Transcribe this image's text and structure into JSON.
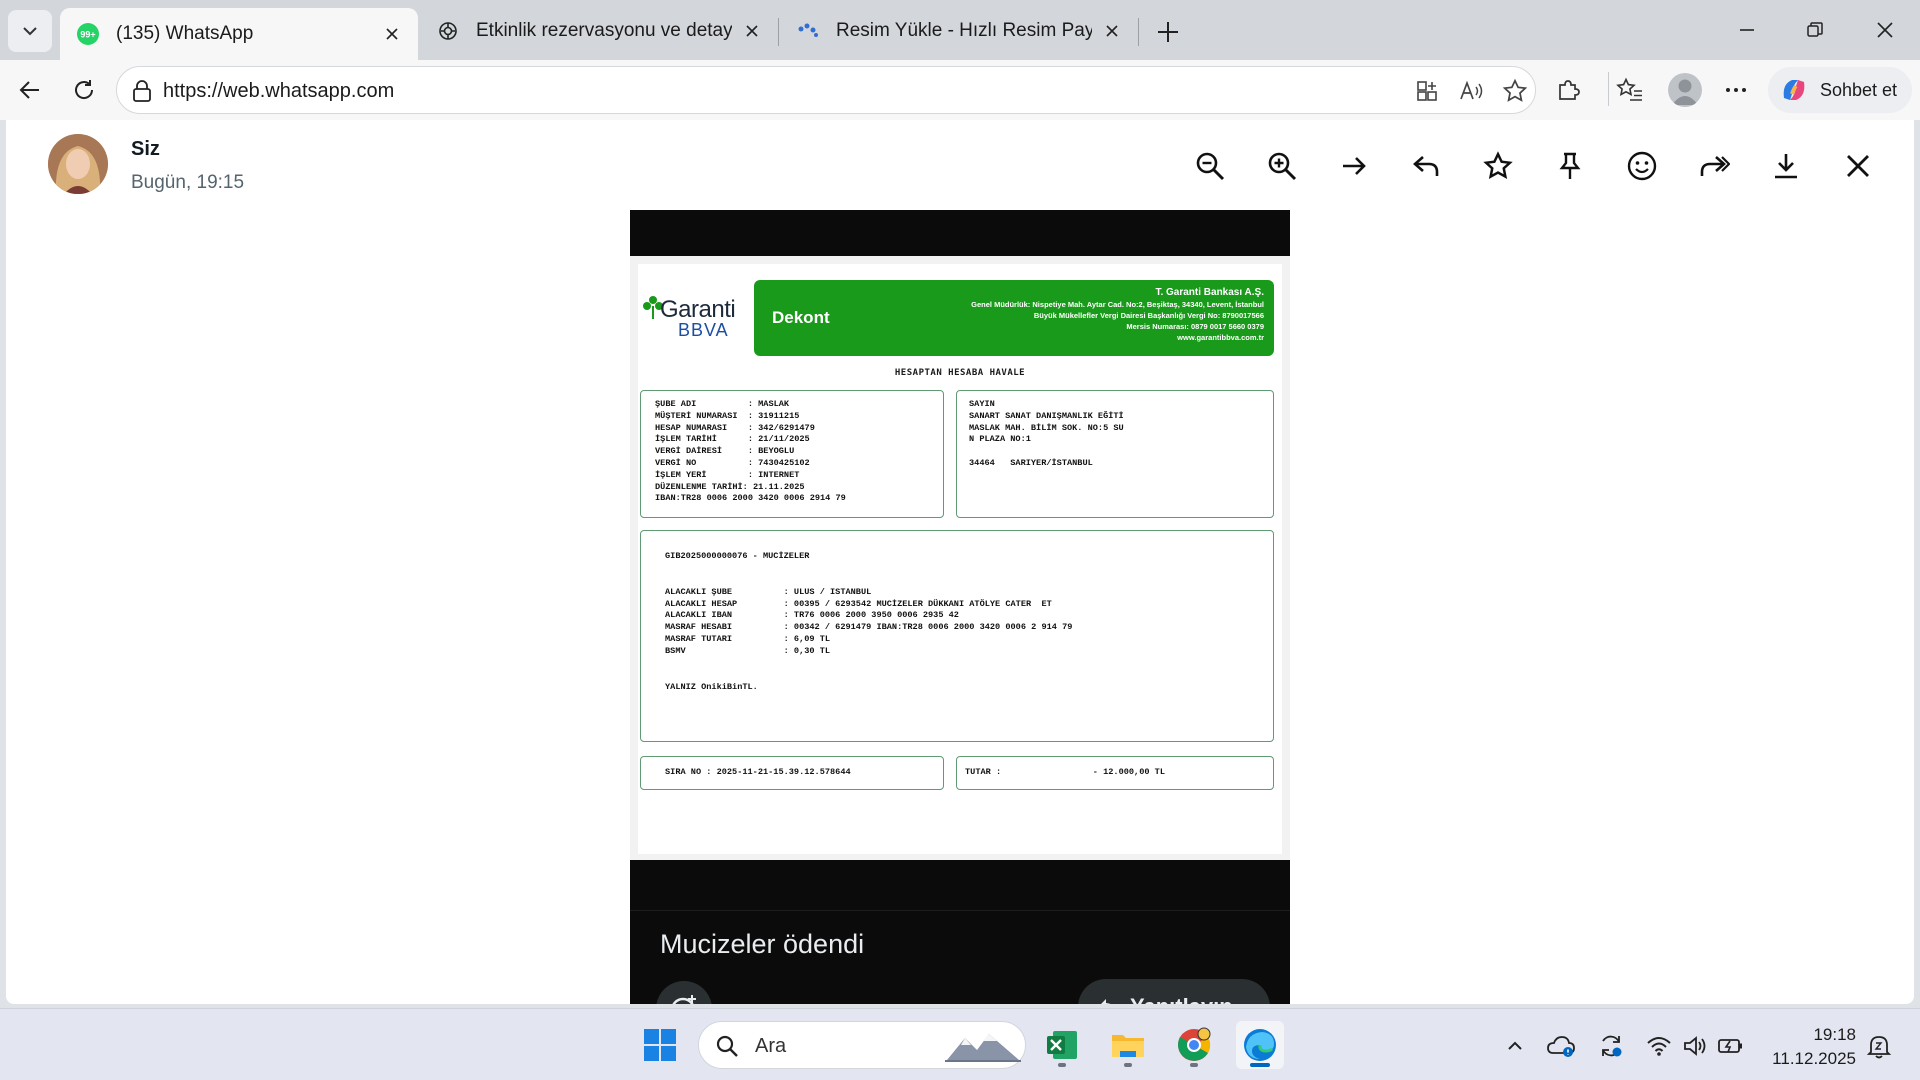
{
  "browser": {
    "tabs": [
      {
        "title": "(135) WhatsApp",
        "badge": "99+",
        "active": true
      },
      {
        "title": "Etkinlik rezervasyonu ve detaylar",
        "active": false
      },
      {
        "title": "Resim Yükle - Hızlı Resim Paylaş - R",
        "active": false
      }
    ],
    "url": "https://web.whatsapp.com",
    "copilot_label": "Sohbet et"
  },
  "viewer": {
    "sender_name": "Siz",
    "sent_time": "Bugün, 19:15",
    "caption": "Mucizeler ödendi",
    "reply_label": "Yanıtlayın"
  },
  "receipt": {
    "logo_garanti": "Garanti",
    "logo_bbva": "BBVA",
    "doc_type": "Dekont",
    "bank_name": "T. Garanti Bankası A.Ş.",
    "bank_line_1": "Genel Müdürlük: Nispetiye Mah. Aytar Cad. No:2, Beşiktaş, 34340, Levent, İstanbul",
    "bank_line_2": "Büyük Mükellefler Vergi Dairesi Başkanlığı Vergi No: 8790017566",
    "bank_line_3": "Mersis Numarası: 0879 0017 5660 0379",
    "bank_line_4": "www.garantibbva.com.tr",
    "title": "HESAPTAN HESABA HAVALE",
    "left_rows": [
      "ŞUBE ADI          : MASLAK",
      "MÜŞTERİ NUMARASI  : 31911215",
      "HESAP NUMARASI    : 342/6291479",
      "İŞLEM TARİHİ      : 21/11/2025",
      "VERGİ DAİRESİ     : BEYOGLU",
      "VERGİ NO          : 7430425102",
      "İŞLEM YERİ        : INTERNET",
      "DÜZENLENME TARİHİ: 21.11.2025",
      "IBAN:TR28 0006 2000 3420 0006 2914 79"
    ],
    "right_rows": [
      "SAYIN",
      "SANART SANAT DANIŞMANLIK EĞİTİ",
      "MASLAK MAH. BİLİM SOK. NO:5 SU",
      "N PLAZA NO:1",
      "",
      "34464   SARIYER/İSTANBUL"
    ],
    "ref_line": "GIB2025000000076 - MUCİZELER",
    "detail_rows": [
      "ALACAKLI ŞUBE          : ULUS / ISTANBUL",
      "ALACAKLI HESAP         : 00395 / 6293542 MUCİZELER DÜKKANI ATÖLYE CATER  ET",
      "ALACAKLI IBAN          : TR76 0006 2000 3950 0006 2935 42",
      "MASRAF HESABI          : 00342 / 6291479 IBAN:TR28 0006 2000 3420 0006 2 914 79",
      "MASRAF TUTARI          : 6,09 TL",
      "BSMV                   : 0,30 TL"
    ],
    "amount_words": "YALNIZ OnikiBinTL.",
    "sira_no": "SIRA NO : 2025-11-21-15.39.12.578644",
    "tutar_label": "TUTAR :",
    "tutar_value": "- 12.000,00 TL"
  },
  "taskbar": {
    "search_placeholder": "Ara",
    "time": "19:18",
    "date": "11.12.2025"
  },
  "colors": {
    "garanti_green": "#1a9a1a",
    "whatsapp_green": "#25d366",
    "panel_border": "#5f9a73"
  }
}
